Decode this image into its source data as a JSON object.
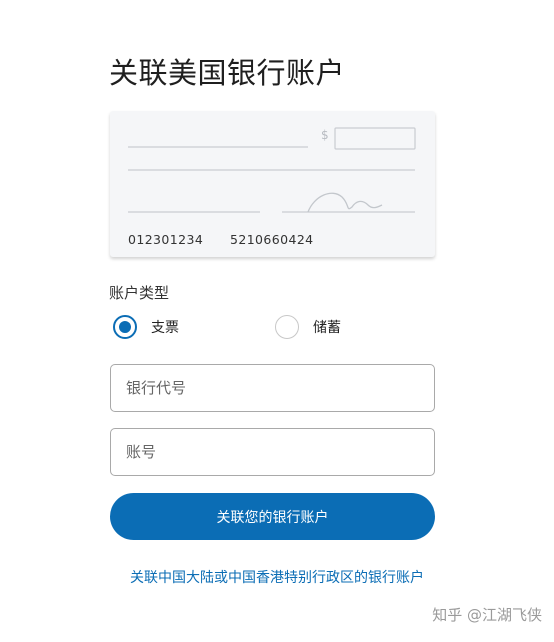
{
  "page": {
    "title": "关联美国银行账户"
  },
  "check": {
    "dollar_sign": "$",
    "routing_number": "012301234",
    "account_number": "5210660424"
  },
  "account_type": {
    "label": "账户类型",
    "options": [
      {
        "label": "支票",
        "selected": true
      },
      {
        "label": "储蓄",
        "selected": false
      }
    ]
  },
  "form": {
    "routing_placeholder": "银行代号",
    "account_placeholder": "账号",
    "submit_label": "关联您的银行账户"
  },
  "footer": {
    "china_link": "关联中国大陆或中国香港特别行政区的银行账户"
  },
  "watermark": {
    "text": "知乎 @江湖飞侠"
  },
  "colors": {
    "accent": "#0b6db5",
    "card_background": "#f5f6f8",
    "input_border": "#a9a9a9"
  }
}
